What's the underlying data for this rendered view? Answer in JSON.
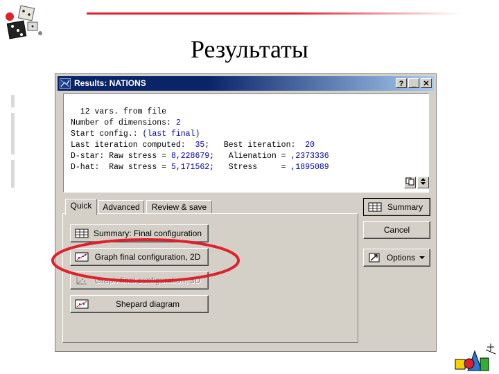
{
  "slide": {
    "title": "Результаты"
  },
  "window": {
    "title": "Results: NATIONS",
    "controls": {
      "help": "?",
      "minimize": "_",
      "close": "✕"
    }
  },
  "output": {
    "lines": [
      {
        "text": "  12 vars. from file"
      },
      {
        "text": "Number of dimensions: ",
        "value": "2"
      },
      {
        "text": "Start config.: ",
        "value": "(last final)"
      },
      {
        "text": "Last iteration computed:  ",
        "value": "35",
        "text2": ";   Best iteration:  ",
        "value2": "20"
      },
      {
        "text": "D-star: Raw stress = ",
        "value": "8,228679",
        "text2": ";   Alienation = ",
        "value2": ",2373336"
      },
      {
        "text": "D-hat:  Raw stress = ",
        "value": "5,171562",
        "text2": ";   Stress     = ",
        "value2": ",1895089"
      }
    ]
  },
  "tabs": [
    {
      "label": "Quick",
      "active": true
    },
    {
      "label": "Advanced",
      "active": false
    },
    {
      "label": "Review & save",
      "active": false
    }
  ],
  "quick_buttons": [
    {
      "label": "Summary: Final configuration",
      "icon": "table-icon",
      "enabled": true
    },
    {
      "label": "Graph final configuration, 2D",
      "icon": "scatter-2d-icon",
      "enabled": true
    },
    {
      "label": "Graph final configuration, 3D",
      "icon": "scatter-3d-icon",
      "enabled": false
    },
    {
      "label": "Shepard diagram",
      "icon": "shepard-icon",
      "enabled": true
    }
  ],
  "side_buttons": {
    "summary": "Summary",
    "cancel": "Cancel",
    "options": "Options"
  },
  "colors": {
    "highlight_ellipse": "#e0202a",
    "titlebar": "#0a246a",
    "value_text": "#0000c0"
  }
}
